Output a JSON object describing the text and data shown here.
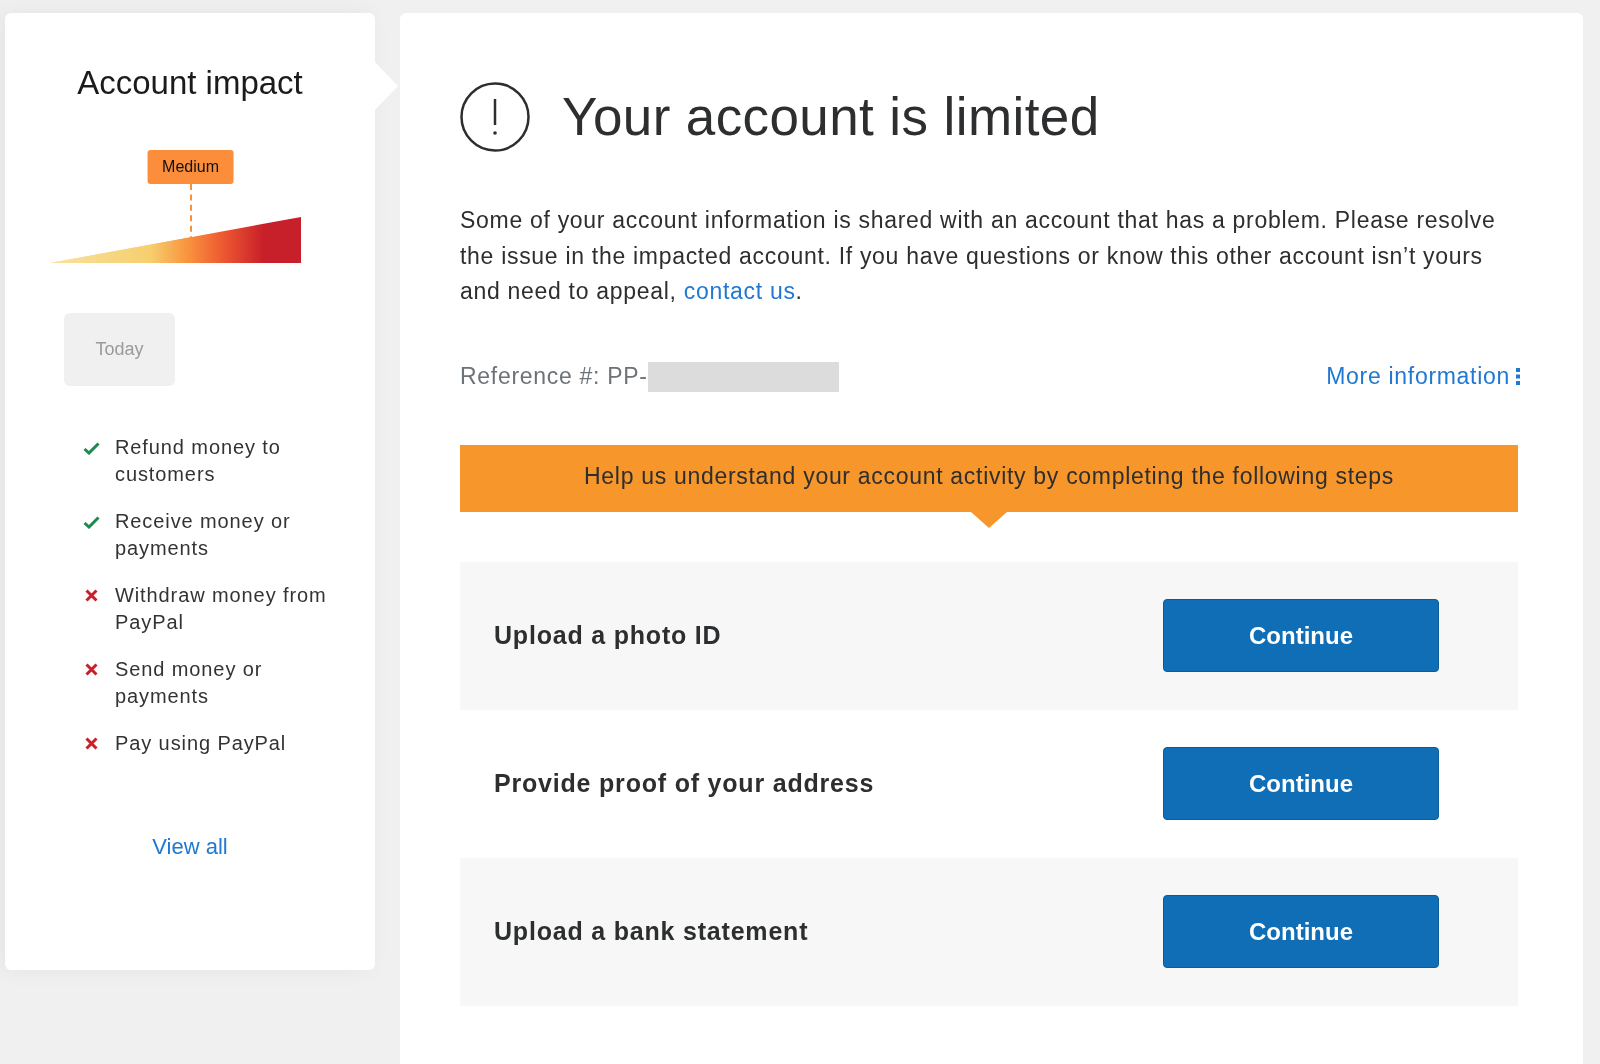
{
  "impact_panel": {
    "title": "Account impact",
    "meter": {
      "label": "Medium",
      "level": 0.56
    },
    "timeline_label": "Today",
    "items": [
      {
        "label": "Refund money to customers",
        "allowed": true
      },
      {
        "label": "Receive money or payments",
        "allowed": true
      },
      {
        "label": "Withdraw money from PayPal",
        "allowed": false
      },
      {
        "label": "Send money or payments",
        "allowed": false
      },
      {
        "label": "Pay using PayPal",
        "allowed": false
      }
    ],
    "link": "View all"
  },
  "main": {
    "title": "Your account is limited",
    "message": {
      "text": "Some of your account information is shared with an account that has a problem. Please resolve the issue in the impacted account. If you have questions or know this other account isn’t yours and need to appeal, ",
      "link": "contact us",
      "end": "."
    },
    "reference_label": "Reference #: PP-",
    "more_link": "More information",
    "banner": "Help us understand your account activity by completing the following steps",
    "steps": [
      {
        "label": "Upload a photo ID",
        "button": "Continue"
      },
      {
        "label": "Provide proof of your address",
        "button": "Continue"
      },
      {
        "label": "Upload a bank statement",
        "button": "Continue"
      }
    ]
  }
}
